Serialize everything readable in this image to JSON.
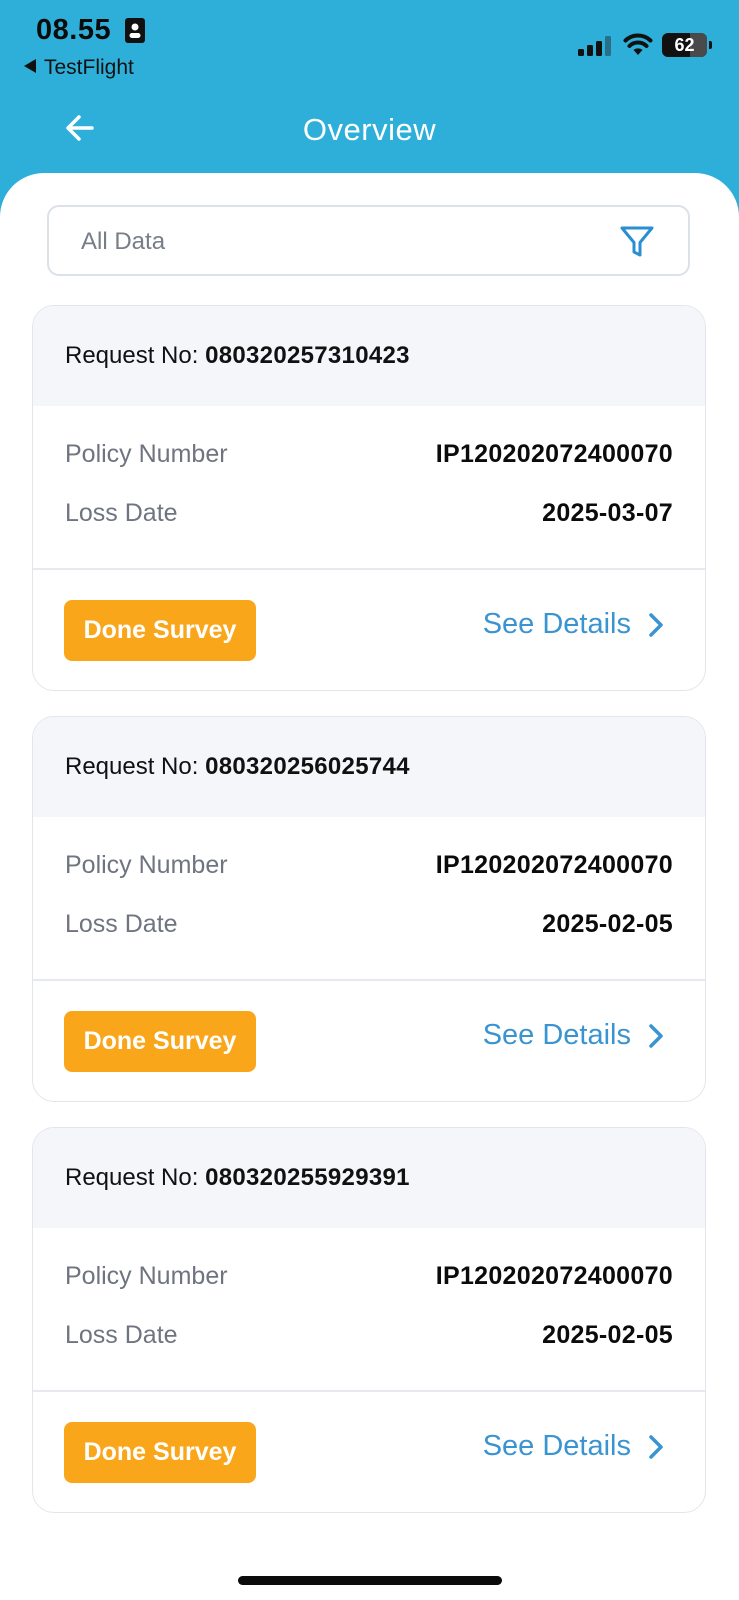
{
  "status_bar": {
    "time": "08.55",
    "back_app": "TestFlight",
    "battery": "62"
  },
  "header": {
    "title": "Overview"
  },
  "filter": {
    "label": "All Data"
  },
  "labels": {
    "request_no": "Request No:",
    "policy_number": "Policy Number",
    "loss_date": "Loss Date",
    "see_details": "See Details"
  },
  "cards": [
    {
      "request_no": "080320257310423",
      "policy_number": "IP120202072400070",
      "loss_date": "2025-03-07",
      "status": "Done Survey"
    },
    {
      "request_no": "080320256025744",
      "policy_number": "IP120202072400070",
      "loss_date": "2025-02-05",
      "status": "Done Survey"
    },
    {
      "request_no": "080320255929391",
      "policy_number": "IP120202072400070",
      "loss_date": "2025-02-05",
      "status": "Done Survey"
    }
  ],
  "colors": {
    "header_bg": "#2EAFD9",
    "badge_bg": "#F9A61A",
    "link": "#3A94D1"
  },
  "icons": [
    "back-arrow-icon",
    "filter-icon",
    "chevron-right-icon",
    "signal-icon",
    "wifi-icon",
    "battery-icon",
    "id-card-icon"
  ]
}
